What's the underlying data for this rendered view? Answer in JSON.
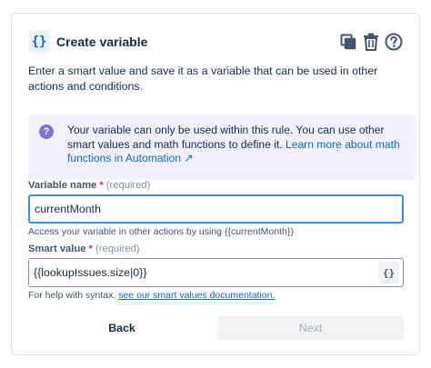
{
  "header": {
    "icon_glyph": "{}",
    "title": "Create variable",
    "actions": [
      {
        "icon": "duplicate-icon"
      },
      {
        "icon": "delete-icon"
      },
      {
        "icon": "help-icon"
      }
    ]
  },
  "description": "Enter a smart value and save it as a variable that can be used in other actions and conditions.",
  "info": {
    "icon": "question-icon",
    "text": "Your variable can only be used within this rule. You can use other smart values and math functions to define it. ",
    "link_text": "Learn more about math functions in Automation ↗"
  },
  "variable_name": {
    "label": "Variable name",
    "required_mark": "*",
    "required_hint": "(required)",
    "value": "currentMonth",
    "help": "Access your variable in other actions by using {{currentMonth}}"
  },
  "smart_value": {
    "label": "Smart value",
    "required_mark": "*",
    "required_hint": "(required)",
    "value": "{{lookupIssues.size|0}}",
    "button_glyph": "{}",
    "help_prefix": "For help with syntax, ",
    "help_link": "see our smart values documentation."
  },
  "footer": {
    "back_label": "Back",
    "next_label": "Next"
  },
  "colors": {
    "accent": "#0c66e4",
    "focus_border": "#388bff",
    "info_bg": "#f3f0ff",
    "info_icon": "#8270db",
    "required": "#c9372c"
  }
}
